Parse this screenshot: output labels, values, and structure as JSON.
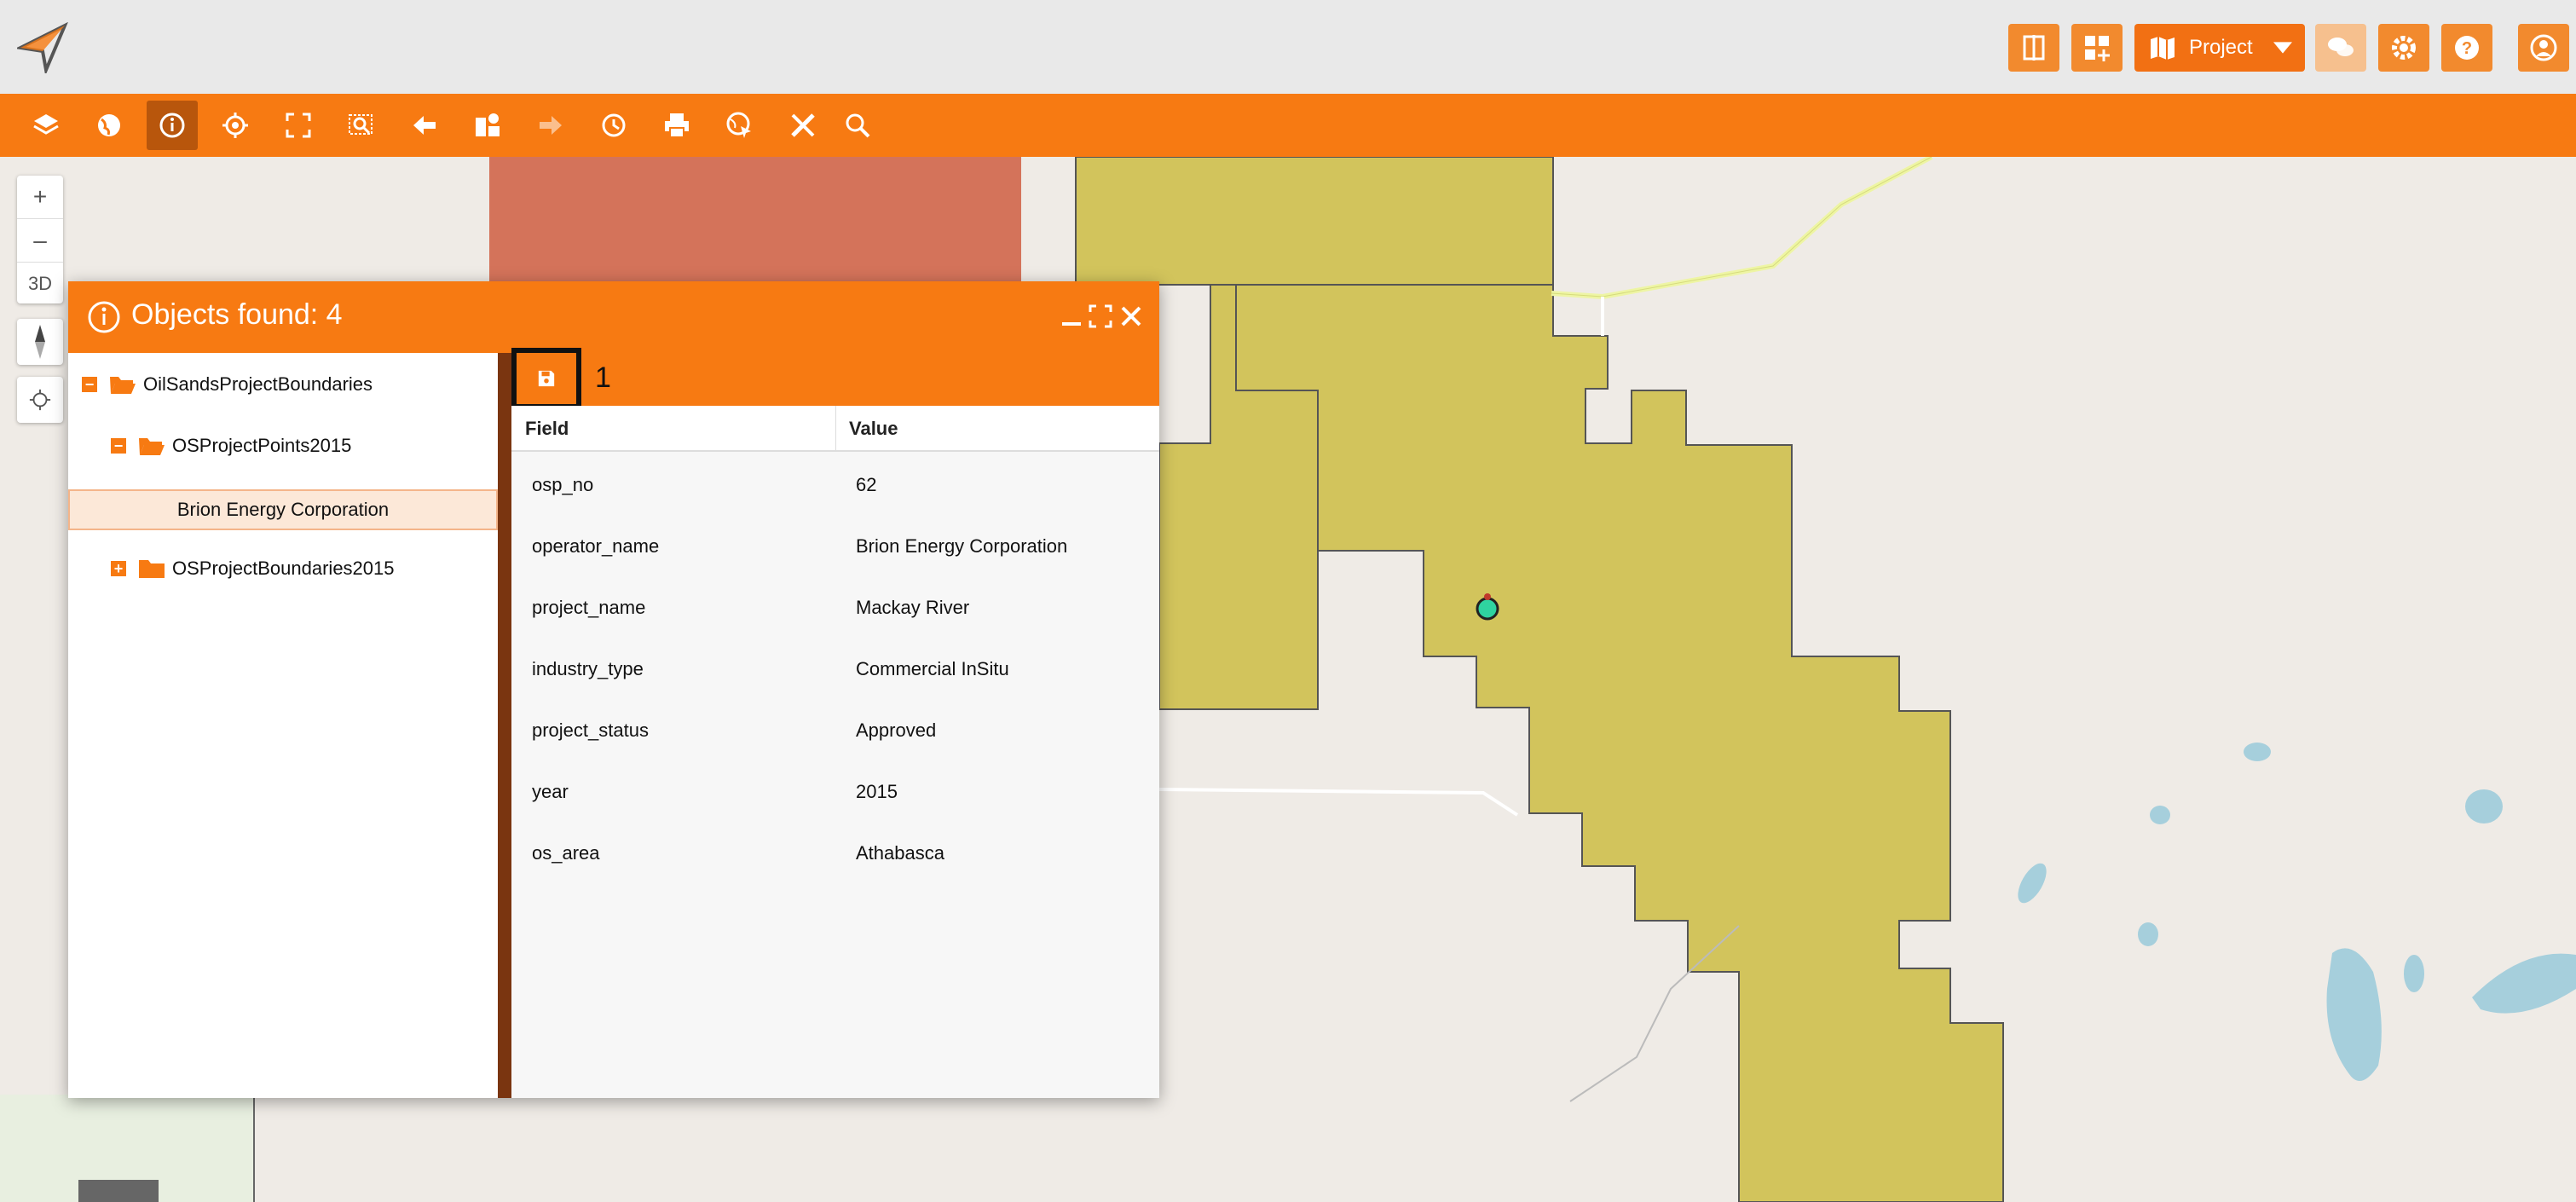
{
  "header": {
    "project_label": "Project",
    "buttons": [
      "split-view-icon",
      "add-widget-icon",
      "map-icon",
      "chat-icon",
      "settings-icon",
      "help-icon",
      "user-icon"
    ]
  },
  "toolbar": {
    "tools": [
      "layers-icon",
      "globe-icon",
      "info-icon",
      "locate-icon",
      "fullscreen-icon",
      "zoom-box-icon",
      "back-arrow-icon",
      "pieces-icon",
      "forward-arrow-icon",
      "history-icon",
      "print-icon",
      "globe-pointer-icon",
      "measure-tools-icon",
      "search-icon"
    ],
    "active": "info-icon"
  },
  "map_controls": {
    "zoom_in": "+",
    "zoom_out": "–",
    "view3d": "3D"
  },
  "dialog": {
    "title": "Objects found: 4",
    "tree": [
      {
        "label": "OilSandsProjectBoundaries",
        "expanded": true
      },
      {
        "label": "OSProjectPoints2015",
        "expanded": true
      },
      {
        "label": "Brion Energy Corporation",
        "selected": true
      },
      {
        "label": "OSProjectBoundaries2015",
        "expanded": false
      }
    ],
    "result_count": "1",
    "columns": {
      "field": "Field",
      "value": "Value"
    },
    "rows": [
      {
        "field": "osp_no",
        "value": "62"
      },
      {
        "field": "operator_name",
        "value": "Brion Energy Corporation"
      },
      {
        "field": "project_name",
        "value": "Mackay River"
      },
      {
        "field": "industry_type",
        "value": "Commercial InSitu"
      },
      {
        "field": "project_status",
        "value": "Approved"
      },
      {
        "field": "year",
        "value": "2015"
      },
      {
        "field": "os_area",
        "value": "Athabasca"
      }
    ]
  },
  "colors": {
    "accent": "#f77a12",
    "polygon": "#d2c45c",
    "water": "#a6cfdc",
    "highlight_polygon": "#d4735a"
  }
}
